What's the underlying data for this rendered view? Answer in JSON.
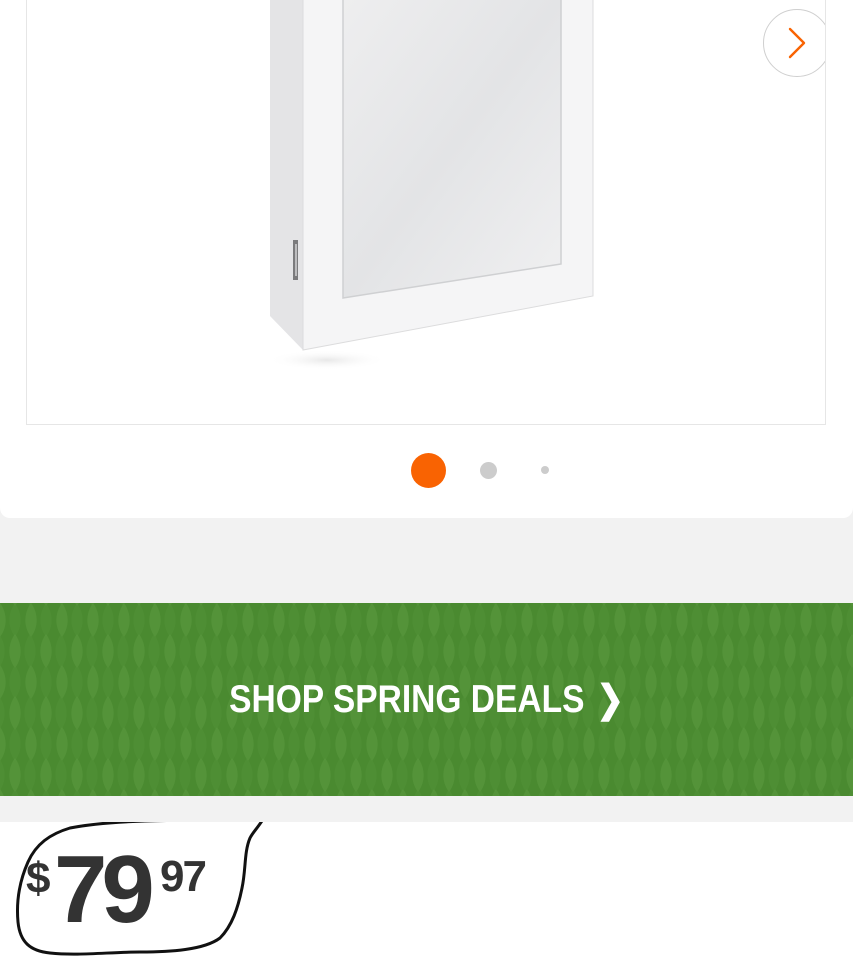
{
  "gallery": {
    "next_icon": "chevron-right-icon",
    "pagination": {
      "count": 3,
      "active_index": 0
    },
    "colors": {
      "active_dot": "#f96302",
      "inactive_dot": "#cccccc"
    }
  },
  "banner": {
    "label": "SHOP SPRING DEALS",
    "chevron": "❯",
    "background": "#4a8a30"
  },
  "price": {
    "currency": "$",
    "dollars": "79",
    "cents": "97"
  }
}
